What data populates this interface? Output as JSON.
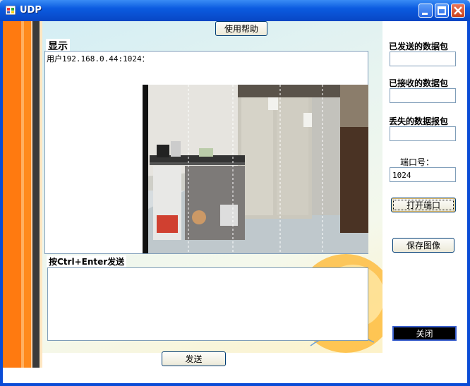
{
  "window": {
    "title": "UDP"
  },
  "buttons": {
    "help": "使用帮助",
    "open_port": "打开端口",
    "save_image": "保存图像",
    "close": "关闭",
    "send": "发送"
  },
  "display": {
    "label": "显示",
    "line1": "用户192.168.0.44:1024："
  },
  "send_area": {
    "label": "按Ctrl+Enter发送",
    "value": ""
  },
  "stats": {
    "sent_label": "已发送的数据包",
    "sent_value": "",
    "received_label": "已接收的数据包",
    "received_value": "",
    "lost_label": "丢失的数据报包",
    "lost_value": "",
    "port_label": "端口号：",
    "port_value": "1024"
  },
  "colors": {
    "stripe_orange": "#ff7a10",
    "stripe_dark": "#3a3a3a",
    "titlebar": "#0b5be0"
  }
}
